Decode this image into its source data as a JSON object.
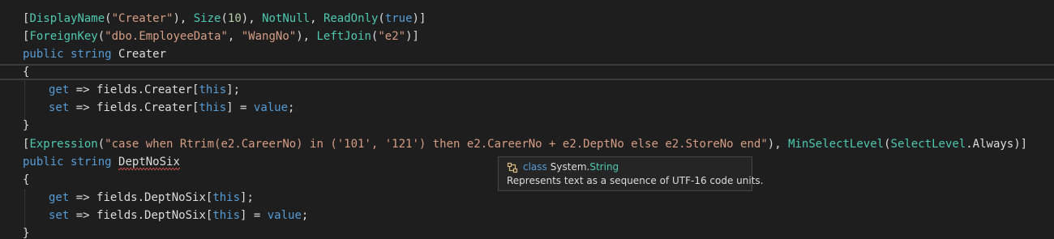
{
  "colors": {
    "background": "#1e1e1e",
    "keyword": "#569cd6",
    "type": "#4ec9b0",
    "string": "#d69d85",
    "number": "#b5cea8",
    "text": "#dcdcdc",
    "error_squiggle": "#e05252"
  },
  "code": {
    "l1": {
      "b1": "[",
      "a1": "DisplayName",
      "p1": "(",
      "s1": "\"Creater\"",
      "p2": "), ",
      "a2": "Size",
      "p3": "(",
      "n1": "10",
      "p4": "), ",
      "a3": "NotNull",
      "p5": ", ",
      "a4": "ReadOnly",
      "p6": "(",
      "k1": "true",
      "p7": ")]"
    },
    "l2": {
      "b1": "[",
      "a1": "ForeignKey",
      "p1": "(",
      "s1": "\"dbo.EmployeeData\"",
      "p2": ", ",
      "s2": "\"WangNo\"",
      "p3": "), ",
      "a2": "LeftJoin",
      "p4": "(",
      "s3": "\"e2\"",
      "p5": ")]"
    },
    "l3": {
      "k1": "public",
      "sp1": " ",
      "k2": "string",
      "sp2": " ",
      "id": "Creater"
    },
    "l4": {
      "text": "{"
    },
    "l5": {
      "k1": "get",
      "p1": " => fields.Creater[",
      "k2": "this",
      "p2": "];"
    },
    "l6": {
      "k1": "set",
      "p1": " => fields.Creater[",
      "k2": "this",
      "p2": "] = ",
      "k3": "value",
      "p3": ";"
    },
    "l7": {
      "text": "}"
    },
    "l8": {
      "b1": "[",
      "a1": "Expression",
      "p1": "(",
      "s1": "\"case when Rtrim(e2.CareerNo) in ('101', '121') then e2.CareerNo + e2.DeptNo else e2.StoreNo end\"",
      "p2": "), ",
      "a2": "MinSelectLevel",
      "p3": "(",
      "c1": "SelectLevel",
      "p4": ".Always)]"
    },
    "l9": {
      "k1": "public",
      "sp1": " ",
      "k2": "string",
      "sp2": " ",
      "id": "DeptNoSix"
    },
    "l10": {
      "text": "{"
    },
    "l11": {
      "k1": "get",
      "p1": " => fields.DeptNoSix[",
      "k2": "this",
      "p2": "];"
    },
    "l12": {
      "k1": "set",
      "p1": " => fields.DeptNoSix[",
      "k2": "this",
      "p2": "] = ",
      "k3": "value",
      "p3": ";"
    },
    "l13": {
      "text": "}"
    }
  },
  "tooltip": {
    "icon": "class-icon",
    "keyword": "class",
    "namespace": "System.",
    "type_name": "String",
    "description": "Represents text as a sequence of UTF-16 code units."
  }
}
